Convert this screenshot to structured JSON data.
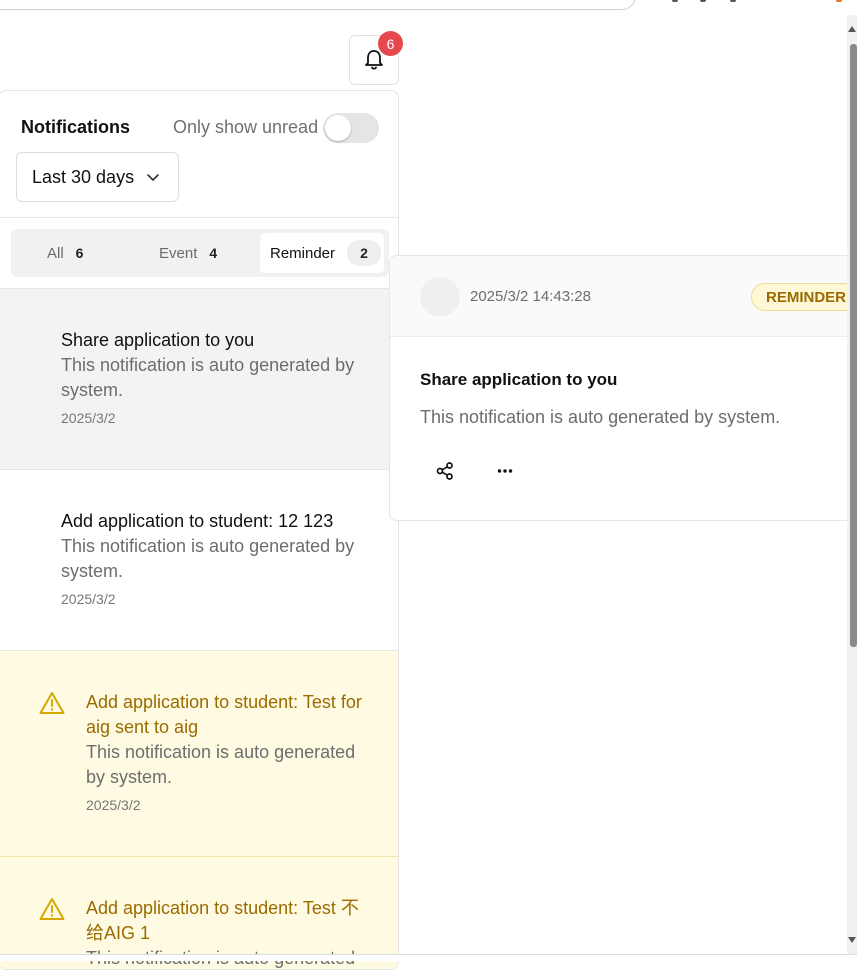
{
  "header": {
    "bell_badge_count": "6"
  },
  "panel": {
    "title": "Notifications",
    "unread_label": "Only show unread",
    "unread_toggle_on": false,
    "range_value": "Last 30 days",
    "tabs": [
      {
        "label": "All",
        "count": "6",
        "active": false
      },
      {
        "label": "Event",
        "count": "4",
        "active": false
      },
      {
        "label": "Reminder",
        "count": "2",
        "active": true
      }
    ],
    "items": [
      {
        "title": "Share application to you",
        "desc_line1": "This notification is auto generated by",
        "desc_line2": "system.",
        "date": "2025/3/2",
        "type": "selected"
      },
      {
        "title": "Add application to student: 12 123",
        "desc_line1": "This notification is auto generated by",
        "desc_line2": "system.",
        "date": "2025/3/2",
        "type": "normal"
      },
      {
        "title_line1": "Add application to student: Test for",
        "title_line2": "aig sent to aig",
        "desc_line1": "This notification is auto generated",
        "desc_line2": "by system.",
        "date": "2025/3/2",
        "type": "warning"
      },
      {
        "title_line1": "Add application to student: Test 不",
        "title_line2": "给AIG 1",
        "desc_line1": "This notification is auto generated",
        "type": "warning"
      }
    ]
  },
  "detail": {
    "timestamp": "2025/3/2 14:43:28",
    "badge": "REMINDER",
    "title": "Share application to you",
    "desc": "This notification is auto generated by system."
  },
  "colors": {
    "badge_red": "#e5484d",
    "warning_bg": "#fffbe3",
    "warning_text": "#9a6b00",
    "selected_bg": "#f3f3f3"
  }
}
